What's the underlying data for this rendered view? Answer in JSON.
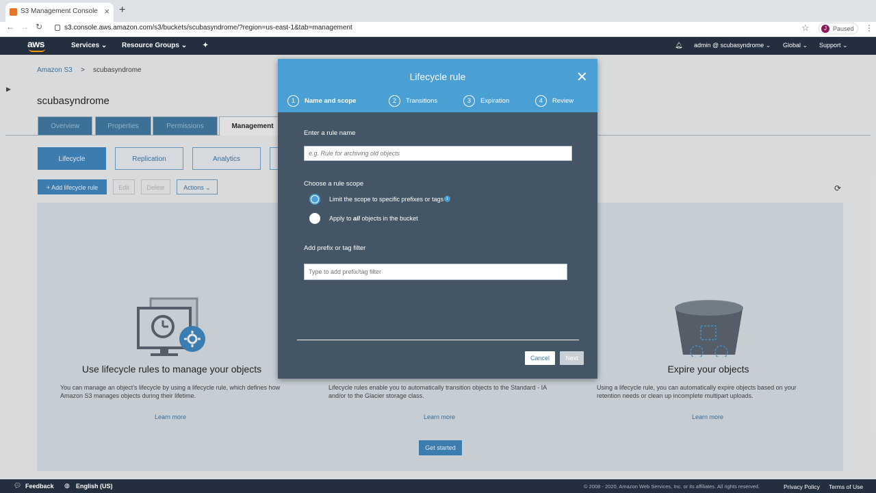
{
  "browser": {
    "tab_title": "S3 Management Console",
    "url": "s3.console.aws.amazon.com/s3/buckets/scubasyndrome/?region=us-east-1&tab=management",
    "profile_initial": "J",
    "profile_status": "Paused"
  },
  "aws_nav": {
    "logo": "aws",
    "services": "Services",
    "resource_groups": "Resource Groups",
    "account": "admin @ scubasyndrome",
    "region": "Global",
    "support": "Support"
  },
  "breadcrumb": {
    "root": "Amazon S3",
    "separator": ">",
    "current": "scubasyndrome"
  },
  "bucket_name": "scubasyndrome",
  "top_tabs": [
    "Overview",
    "Properties",
    "Permissions",
    "Management"
  ],
  "sub_tabs": [
    "Lifecycle",
    "Replication",
    "Analytics"
  ],
  "actions": {
    "add": "+ Add lifecycle rule",
    "edit": "Edit",
    "delete": "Delete",
    "actions": "Actions"
  },
  "cards": [
    {
      "title": "Use lifecycle rules to manage your objects",
      "desc": "You can manage an object's lifecycle by using a lifecycle rule, which defines how Amazon S3 manages objects during their lifetime.",
      "link": "Learn more"
    },
    {
      "title": "",
      "desc": "Lifecycle rules enable you to automatically transition objects to the Standard - IA and/or to the Glacier storage class.",
      "link": "Learn more"
    },
    {
      "title": "Expire your objects",
      "desc": "Using a lifecycle rule, you can automatically expire objects based on your retention needs or clean up incomplete multipart uploads.",
      "link": "Learn more"
    }
  ],
  "get_started": "Get started",
  "modal": {
    "title": "Lifecycle rule",
    "steps": [
      {
        "num": "1",
        "label": "Name and scope"
      },
      {
        "num": "2",
        "label": "Transitions"
      },
      {
        "num": "3",
        "label": "Expiration"
      },
      {
        "num": "4",
        "label": "Review"
      }
    ],
    "rule_name_label": "Enter a rule name",
    "rule_name_placeholder": "e.g. Rule for archiving old objects",
    "scope_label": "Choose a rule scope",
    "scope_option1": "Limit the scope to specific prefixes or tags",
    "scope_option2_pre": "Apply to ",
    "scope_option2_em": "all",
    "scope_option2_post": " objects in the bucket",
    "filter_label": "Add prefix or tag filter",
    "filter_placeholder": "Type to add prefix/tag filter",
    "cancel": "Cancel",
    "next": "Next"
  },
  "footer": {
    "feedback": "Feedback",
    "language": "English (US)",
    "copyright": "© 2008 - 2020, Amazon Web Services, Inc. or its affiliates. All rights reserved.",
    "privacy": "Privacy Policy",
    "terms": "Terms of Use"
  }
}
